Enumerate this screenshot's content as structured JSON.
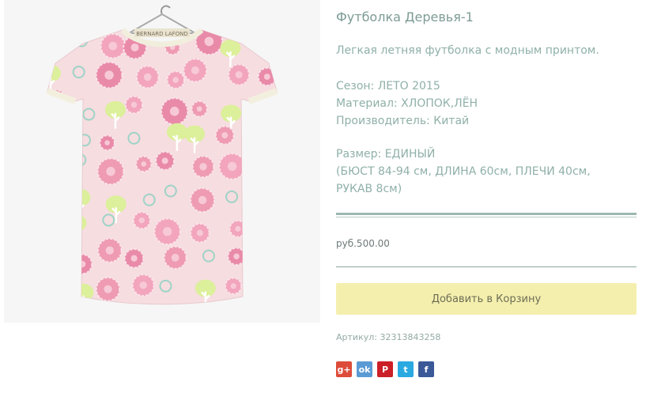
{
  "product": {
    "title": "Футболка Деревья-1",
    "description": "Легкая летняя футболка с модным принтом.",
    "season": "Сезон: ЛЕТО 2015",
    "material": "Материал: ХЛОПОК,ЛЁН",
    "manufacturer": "Производитель: Китай",
    "size_line1": "Размер: ЕДИНЫЙ",
    "size_line2": "(БЮСТ 84-94 см, ДЛИНА 60см, ПЛЕЧИ 40см,",
    "size_line3": "РУКАВ 8см)",
    "price": "руб.500.00",
    "add_to_cart": "Добавить в Корзину",
    "sku": "Артикул: 32313843258",
    "label_text": "BERNARD LAFOND"
  },
  "share": [
    {
      "icon": "google-plus-icon",
      "glyph": "g+",
      "color": "#dd4b39"
    },
    {
      "icon": "odnoklassniki-icon",
      "glyph": "ok",
      "color": "#5b9bd5"
    },
    {
      "icon": "pinterest-icon",
      "glyph": "P",
      "color": "#cb2027"
    },
    {
      "icon": "twitter-icon",
      "glyph": "t",
      "color": "#2ba9e1"
    },
    {
      "icon": "facebook-icon",
      "glyph": "f",
      "color": "#3b5998"
    }
  ]
}
